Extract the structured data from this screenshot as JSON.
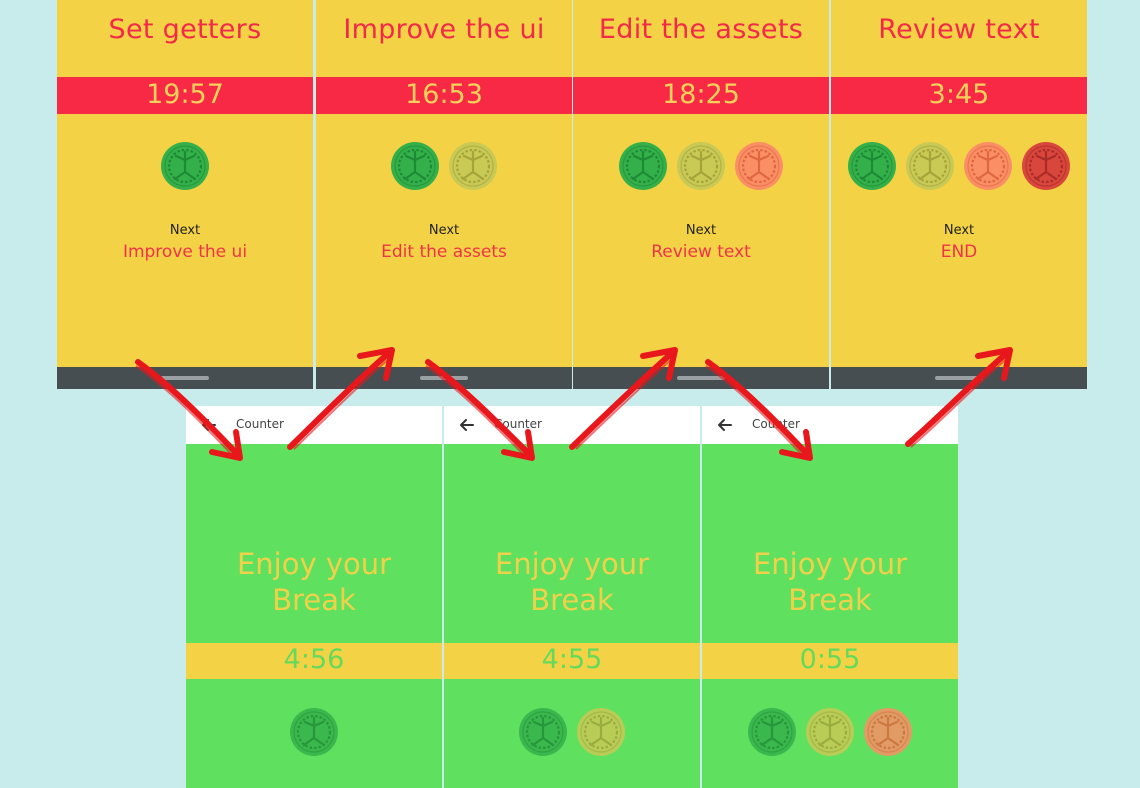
{
  "colors": {
    "background": "#c8eceb",
    "task_bg": "#f4d245",
    "task_accent": "#f72945",
    "break_bg": "#5fe05f",
    "arrow": "#e8171c"
  },
  "task_screens": [
    {
      "title": "Set getters",
      "timer": "19:57",
      "next_label": "Next",
      "next_task": "Improve the ui",
      "tomatoes": [
        "green"
      ]
    },
    {
      "title": "Improve the ui",
      "timer": "16:53",
      "next_label": "Next",
      "next_task": "Edit the assets",
      "tomatoes": [
        "green",
        "olive"
      ]
    },
    {
      "title": "Edit the assets",
      "timer": "18:25",
      "next_label": "Next",
      "next_task": "Review text",
      "tomatoes": [
        "green",
        "olive",
        "orange"
      ]
    },
    {
      "title": "Review text",
      "timer": "3:45",
      "next_label": "Next",
      "next_task": "END",
      "tomatoes": [
        "green",
        "olive",
        "orange",
        "red"
      ]
    }
  ],
  "break_screens": [
    {
      "app_title": "Counter",
      "message_line1": "Enjoy your",
      "message_line2": "Break",
      "timer": "4:56",
      "tomatoes": [
        "green"
      ]
    },
    {
      "app_title": "Counter",
      "message_line1": "Enjoy your",
      "message_line2": "Break",
      "timer": "4:55",
      "tomatoes": [
        "green",
        "olive"
      ]
    },
    {
      "app_title": "Counter",
      "message_line1": "Enjoy your",
      "message_line2": "Break",
      "timer": "0:55",
      "tomatoes": [
        "green",
        "olive",
        "orange"
      ]
    }
  ],
  "tomato_colors": {
    "green": {
      "fill": "#34b04a",
      "seed": "#1f8a35"
    },
    "olive": {
      "fill": "#c9c955",
      "seed": "#a4a43a"
    },
    "orange": {
      "fill": "#fa8f66",
      "seed": "#e0663e"
    },
    "red": {
      "fill": "#d9463c",
      "seed": "#a92c28"
    }
  }
}
